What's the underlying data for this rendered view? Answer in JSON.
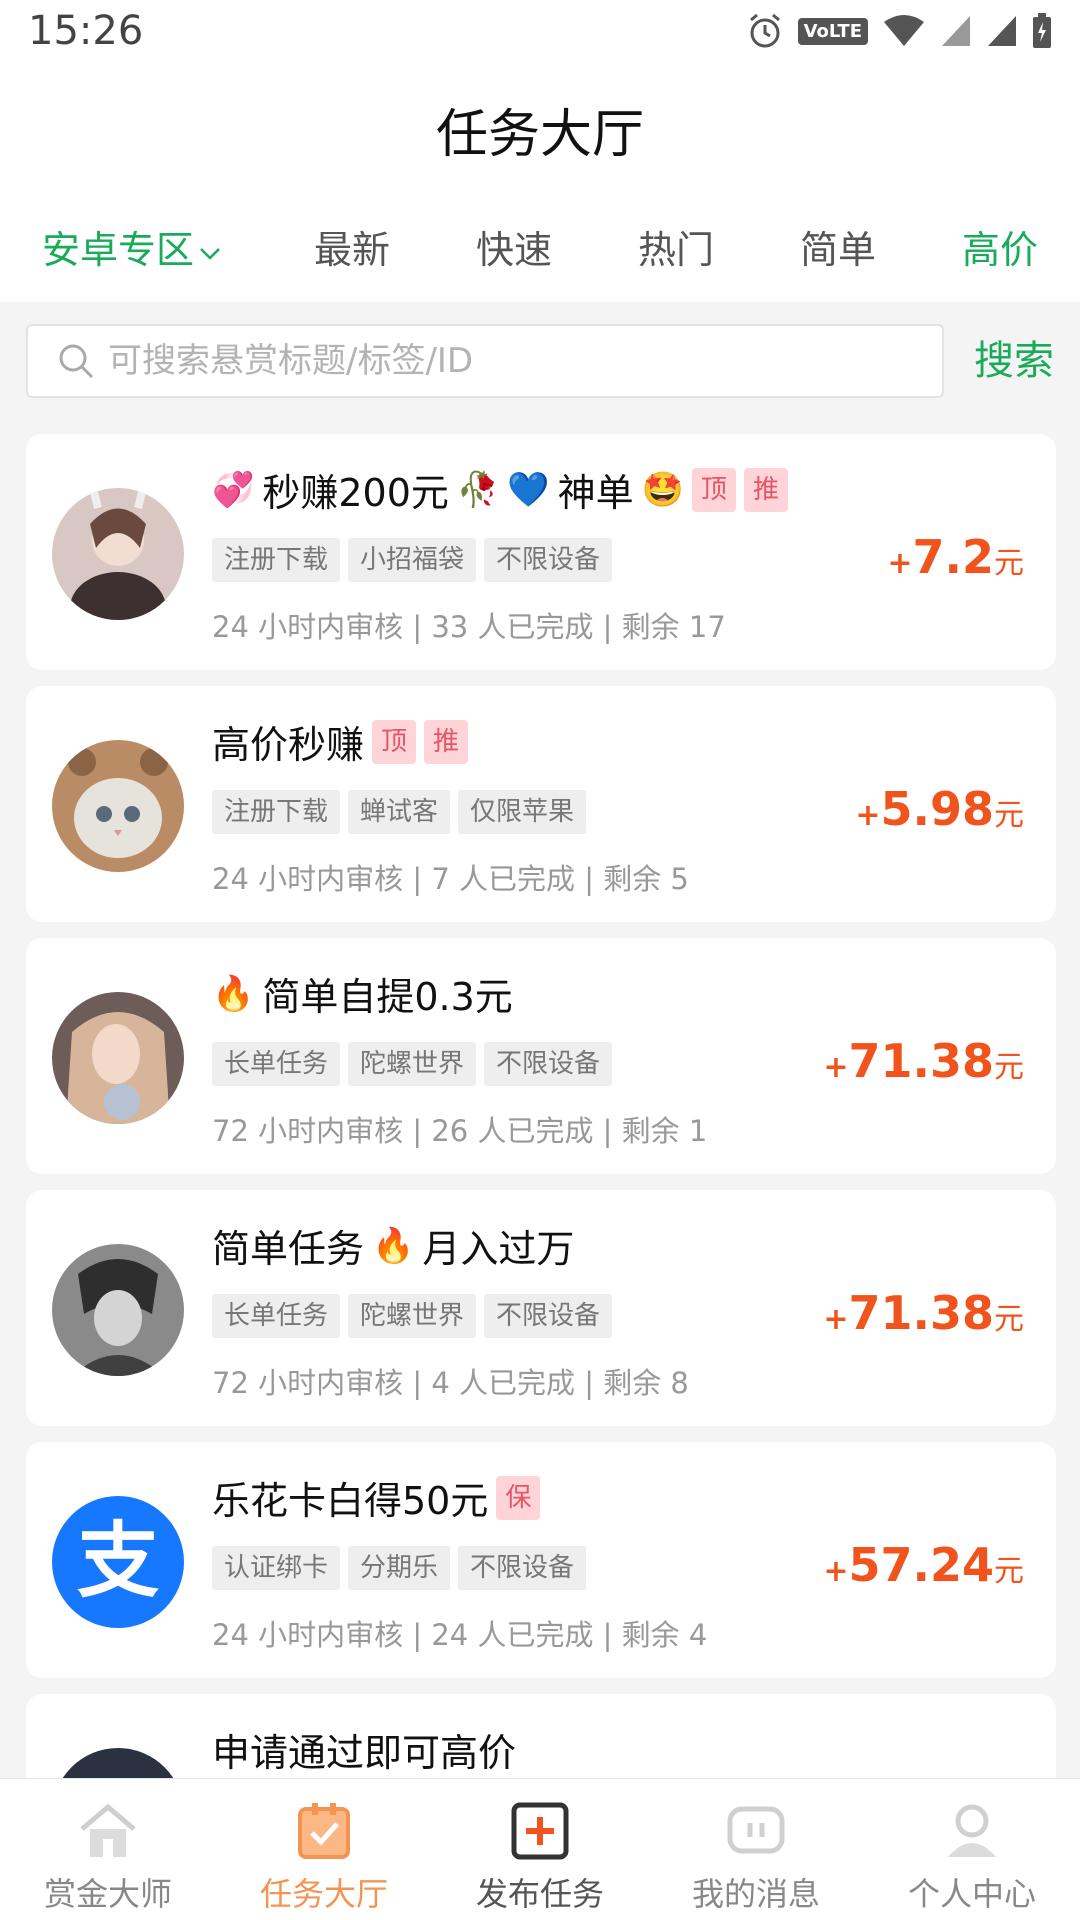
{
  "status_bar": {
    "time": "15:26",
    "volte": "VoLTE"
  },
  "header": {
    "title": "任务大厅"
  },
  "tabs": [
    {
      "label": "安卓专区"
    },
    {
      "label": "最新"
    },
    {
      "label": "快速"
    },
    {
      "label": "热门"
    },
    {
      "label": "简单"
    },
    {
      "label": "高价"
    }
  ],
  "search": {
    "placeholder": "可搜索悬赏标题/标签/ID",
    "button_label": "搜索"
  },
  "tasks": [
    {
      "title": "秒赚200元",
      "title_suffix": "神单",
      "badges": [
        "顶",
        "推"
      ],
      "tags": [
        "注册下载",
        "小招福袋",
        "不限设备"
      ],
      "meta": "24 小时内审核 | 33 人已完成 | 剩余 17",
      "price_sign": "+",
      "price": "7.2",
      "unit": "元"
    },
    {
      "title": "高价秒赚",
      "badges": [
        "顶",
        "推"
      ],
      "tags": [
        "注册下载",
        "蝉试客",
        "仅限苹果"
      ],
      "meta": "24 小时内审核 | 7 人已完成 | 剩余 5",
      "price_sign": "+",
      "price": "5.98",
      "unit": "元"
    },
    {
      "title": "简单自提0.3元",
      "tags": [
        "长单任务",
        "陀螺世界",
        "不限设备"
      ],
      "meta": "72 小时内审核 | 26 人已完成 | 剩余 1",
      "price_sign": "+",
      "price": "71.38",
      "unit": "元"
    },
    {
      "title": "简单任务",
      "title_suffix": "月入过万",
      "tags": [
        "长单任务",
        "陀螺世界",
        "不限设备"
      ],
      "meta": "72 小时内审核 | 4 人已完成 | 剩余 8",
      "price_sign": "+",
      "price": "71.38",
      "unit": "元"
    },
    {
      "title": "乐花卡白得50元",
      "badges": [
        "保"
      ],
      "tags": [
        "认证绑卡",
        "分期乐",
        "不限设备"
      ],
      "meta": "24 小时内审核 | 24 人已完成 | 剩余 4",
      "price_sign": "+",
      "price": "57.24",
      "unit": "元",
      "avatar_glyph": "支"
    },
    {
      "title": "申请通过即可高价"
    }
  ],
  "bottom_nav": [
    {
      "label": "赏金大师",
      "icon": "home-icon"
    },
    {
      "label": "任务大厅",
      "icon": "task-board-icon"
    },
    {
      "label": "发布任务",
      "icon": "publish-plus-icon"
    },
    {
      "label": "我的消息",
      "icon": "message-icon"
    },
    {
      "label": "个人中心",
      "icon": "profile-icon"
    }
  ],
  "colors": {
    "accent_green": "#1aab5a",
    "price_orange": "#f0531c",
    "active_tab_orange": "#f59452",
    "badge_pink": "#ffd4d8"
  }
}
